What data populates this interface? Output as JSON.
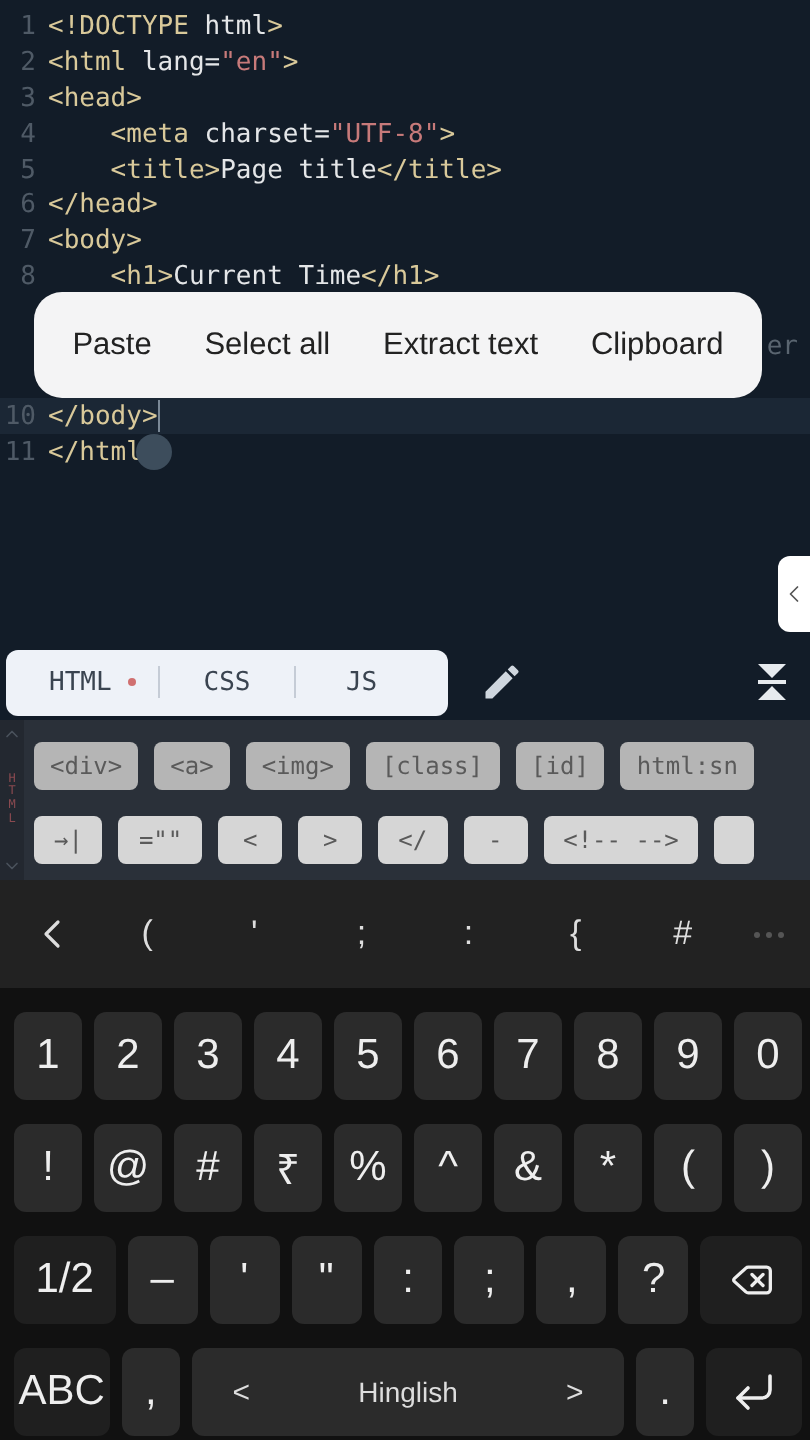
{
  "editor": {
    "lines": [
      {
        "number": "1",
        "current": false,
        "tokens": [
          {
            "kind": "tag",
            "text": "<!DOCTYPE"
          },
          {
            "kind": "plain",
            "text": " html"
          },
          {
            "kind": "tag",
            "text": ">"
          }
        ]
      },
      {
        "number": "2",
        "current": false,
        "tokens": [
          {
            "kind": "tag",
            "text": "<html"
          },
          {
            "kind": "plain",
            "text": " lang="
          },
          {
            "kind": "string",
            "text": "\"en\""
          },
          {
            "kind": "tag",
            "text": ">"
          }
        ]
      },
      {
        "number": "3",
        "current": false,
        "tokens": [
          {
            "kind": "tag",
            "text": "<head>"
          }
        ]
      },
      {
        "number": "4",
        "current": false,
        "tokens": [
          {
            "kind": "tag",
            "text": "    <meta"
          },
          {
            "kind": "plain",
            "text": " charset="
          },
          {
            "kind": "string",
            "text": "\"UTF-8\""
          },
          {
            "kind": "tag",
            "text": ">"
          }
        ]
      },
      {
        "number": "5",
        "current": false,
        "tokens": [
          {
            "kind": "tag",
            "text": "    <title>"
          },
          {
            "kind": "plain",
            "text": "Page title"
          },
          {
            "kind": "tag",
            "text": "</title>"
          }
        ]
      },
      {
        "number": "6",
        "current": false,
        "tokens": [
          {
            "kind": "tag",
            "text": "</head>"
          }
        ]
      },
      {
        "number": "7",
        "current": false,
        "tokens": [
          {
            "kind": "tag",
            "text": "<body>"
          }
        ]
      },
      {
        "number": "8",
        "current": false,
        "tokens": [
          {
            "kind": "tag",
            "text": "    <h1>"
          },
          {
            "kind": "plain",
            "text": "Current Time"
          },
          {
            "kind": "tag",
            "text": "</h1>"
          }
        ]
      },
      {
        "number": "10",
        "current": true,
        "tokens": [
          {
            "kind": "tag",
            "text": "</body>"
          }
        ]
      },
      {
        "number": "11",
        "current": false,
        "tokens": [
          {
            "kind": "tag",
            "text": "</html"
          }
        ]
      }
    ],
    "hidden_line_tail": "er",
    "context_menu": [
      "Paste",
      "Select all",
      "Extract text",
      "Clipboard"
    ]
  },
  "file_tabs": [
    {
      "label": "HTML",
      "modified": true
    },
    {
      "label": "CSS",
      "modified": false
    },
    {
      "label": "JS",
      "modified": false
    }
  ],
  "snippets": {
    "label": "HTML",
    "tags": [
      "<div>",
      "<a>",
      "<img>",
      "[class]",
      "[id]",
      "html:sn"
    ],
    "symbols": [
      "→|",
      "=\"\"",
      "<",
      ">",
      "</",
      "-",
      "<!-- -->"
    ]
  },
  "symbol_bar": [
    "(",
    "'",
    ";",
    ":",
    "{",
    "#"
  ],
  "keyboard": [
    [
      {
        "kind": "char",
        "label": "1"
      },
      {
        "kind": "char",
        "label": "2"
      },
      {
        "kind": "char",
        "label": "3"
      },
      {
        "kind": "char",
        "label": "4"
      },
      {
        "kind": "char",
        "label": "5"
      },
      {
        "kind": "char",
        "label": "6"
      },
      {
        "kind": "char",
        "label": "7"
      },
      {
        "kind": "char",
        "label": "8"
      },
      {
        "kind": "char",
        "label": "9"
      },
      {
        "kind": "char",
        "label": "0"
      }
    ],
    [
      {
        "kind": "char",
        "label": "!"
      },
      {
        "kind": "char",
        "label": "@"
      },
      {
        "kind": "char",
        "label": "#"
      },
      {
        "kind": "char",
        "label": "₹"
      },
      {
        "kind": "char",
        "label": "%"
      },
      {
        "kind": "char",
        "label": "^"
      },
      {
        "kind": "char",
        "label": "&"
      },
      {
        "kind": "char",
        "label": "*"
      },
      {
        "kind": "char",
        "label": "("
      },
      {
        "kind": "char",
        "label": ")"
      }
    ],
    [
      {
        "kind": "mode",
        "label": "1/2"
      },
      {
        "kind": "char",
        "label": "–"
      },
      {
        "kind": "char",
        "label": "'"
      },
      {
        "kind": "char",
        "label": "\""
      },
      {
        "kind": "char",
        "label": ":"
      },
      {
        "kind": "char",
        "label": ";"
      },
      {
        "kind": "char",
        "label": ","
      },
      {
        "kind": "char",
        "label": "?"
      },
      {
        "kind": "backspace"
      }
    ],
    [
      {
        "kind": "mode",
        "label": "ABC"
      },
      {
        "kind": "char",
        "label": ","
      },
      {
        "kind": "space",
        "label": "Hinglish",
        "left": "<",
        "right": ">"
      },
      {
        "kind": "char",
        "label": "."
      },
      {
        "kind": "enter"
      }
    ]
  ]
}
